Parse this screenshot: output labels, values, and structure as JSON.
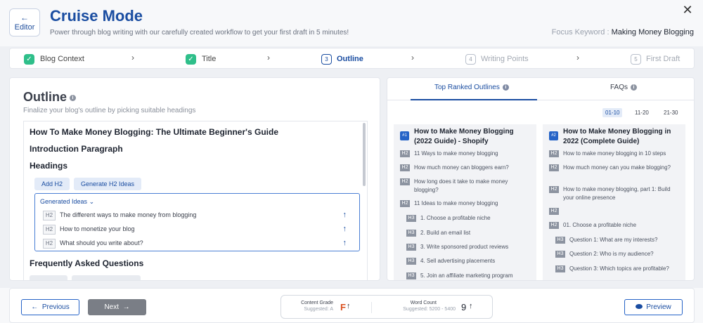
{
  "header": {
    "back_label": "Editor",
    "title": "Cruise Mode",
    "subtitle": "Power through blog writing with our carefully created workflow to get your first draft in 5 minutes!",
    "focus_label": "Focus Keyword :",
    "focus_value": "Making Money Blogging",
    "close_glyph": "✕"
  },
  "steps": [
    {
      "label": "Blog Context",
      "state": "done"
    },
    {
      "label": "Title",
      "state": "done"
    },
    {
      "num": "3",
      "label": "Outline",
      "state": "active"
    },
    {
      "num": "4",
      "label": "Writing Points",
      "state": "todo"
    },
    {
      "num": "5",
      "label": "First Draft",
      "state": "todo"
    }
  ],
  "outline": {
    "heading": "Outline",
    "hint": "Finalize your blog's outline by picking suitable headings",
    "blog_title": "How To Make Money Blogging: The Ultimate Beginner's Guide",
    "intro": "Introduction Paragraph",
    "headings_label": "Headings",
    "add_h2": "Add H2",
    "generate_h2": "Generate H2 Ideas",
    "generated_label": "Generated Ideas",
    "ideas": [
      {
        "tag": "H2",
        "text": "The different ways to make money from blogging"
      },
      {
        "tag": "H2",
        "text": "How to monetize your blog"
      },
      {
        "tag": "H2",
        "text": "What should you write about?"
      }
    ],
    "faq_label": "Frequently Asked Questions"
  },
  "right": {
    "tabs": [
      "Top Ranked Outlines",
      "FAQs"
    ],
    "ranges": [
      "01-10",
      "11-20",
      "21-30"
    ],
    "cards": [
      {
        "rank": "#1",
        "title": "How to Make Money Blogging (2022 Guide) - Shopify",
        "rows": [
          {
            "tag": "H2",
            "text": "11 Ways to make money blogging"
          },
          {
            "tag": "H2",
            "text": "How much money can bloggers earn?"
          },
          {
            "tag": "H2",
            "text": "How long does it take to make money blogging?"
          },
          {
            "tag": "H2",
            "text": "11 Ideas to make money blogging"
          },
          {
            "tag": "H3",
            "text": "1. Choose a profitable niche"
          },
          {
            "tag": "H3",
            "text": "2. Build an email list"
          },
          {
            "tag": "H3",
            "text": "3. Write sponsored product reviews"
          },
          {
            "tag": "H3",
            "text": "4. Sell advertising placements"
          },
          {
            "tag": "H3",
            "text": "5. Join an affiliate marketing program"
          }
        ]
      },
      {
        "rank": "#2",
        "title": "How to Make Money Blogging in 2022 (Complete Guide)",
        "rows": [
          {
            "tag": "H2",
            "text": "How to make money blogging in 10 steps"
          },
          {
            "tag": "H2",
            "text": "How much money can you make blogging?"
          },
          {
            "tag": "H2",
            "text": "How to make money blogging, part 1: Build your online presence"
          },
          {
            "tag": "H2",
            "text": ""
          },
          {
            "tag": "H2",
            "text": "01. Choose a profitable niche"
          },
          {
            "tag": "H3",
            "text": "Question 1: What are my interests?"
          },
          {
            "tag": "H3",
            "text": "Question 2: Who is my audience?"
          },
          {
            "tag": "H3",
            "text": "Question 3: Which topics are profitable?"
          }
        ]
      }
    ]
  },
  "footer": {
    "prev_label": "Previous",
    "next_label": "Next",
    "grade_label": "Content Grade",
    "grade_sub": "Suggested: A",
    "grade_value": "F",
    "wc_label": "Word Count",
    "wc_sub": "Suggested: 5200 - 5400",
    "wc_value": "9",
    "preview_label": "Preview"
  }
}
